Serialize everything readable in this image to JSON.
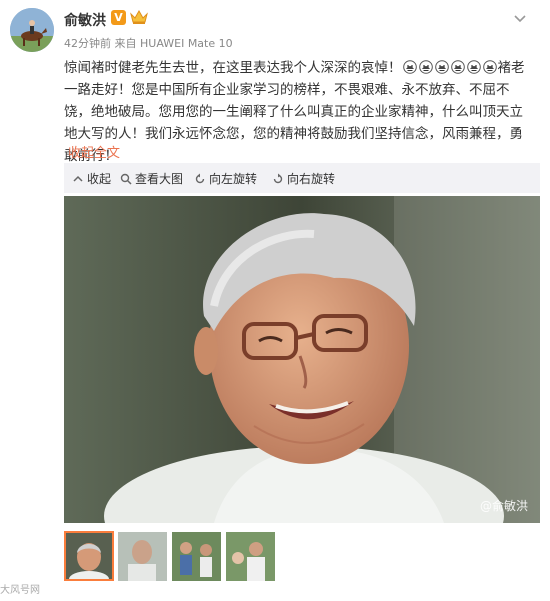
{
  "user": {
    "name": "俞敏洪",
    "verified_badge": "V"
  },
  "meta": {
    "time": "42分钟前",
    "source_prefix": "来自",
    "device": "HUAWEI Mate 10"
  },
  "post": {
    "text_part1": "惊闻褚时健老先生去世，在这里表达我个人深深的哀悼！",
    "text_part2": "褚老一路走好！您是中国所有企业家学习的榜样，不畏艰难、永不放弃、不屈不饶，绝地破局。您用您的一生阐释了什么叫真正的企业家精神，什么叫顶天立地大写的人！我们永远怀念您，您的精神将鼓励我们坚持信念，风雨兼程，勇敢前行！",
    "collapse_label": "收起全文",
    "mourn_icon_count": 6
  },
  "toolbar": {
    "collapse": "收起",
    "view_large": "查看大图",
    "rotate_left": "向左旋转",
    "rotate_right": "向右旋转"
  },
  "photo": {
    "watermark": "@俞敏洪"
  },
  "thumbnails": {
    "count": 4,
    "selected_index": 0
  },
  "corner_mark": "大风号网",
  "colors": {
    "accent": "#eb7350",
    "toolbar_bg": "#f2f2f5",
    "selected_thumb": "#fa7d3c",
    "badge": "#f39a19"
  }
}
